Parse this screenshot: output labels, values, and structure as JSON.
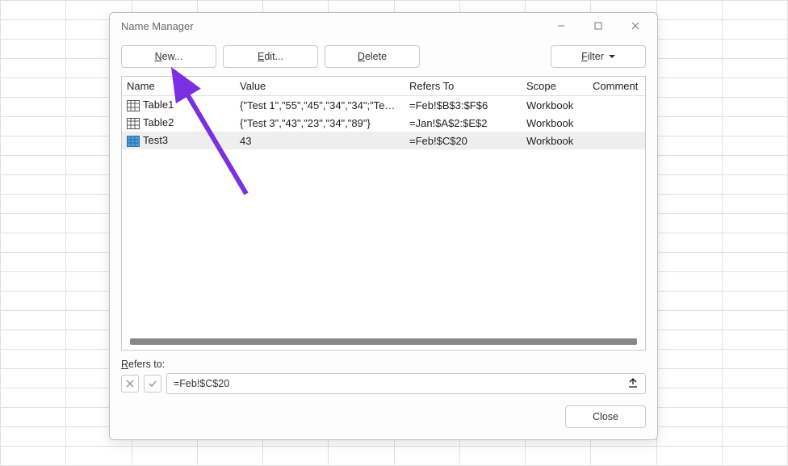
{
  "window": {
    "title": "Name Manager"
  },
  "toolbar": {
    "new_label": "New...",
    "edit_label": "Edit...",
    "delete_label": "Delete",
    "filter_label": "Filter"
  },
  "headers": {
    "name": "Name",
    "value": "Value",
    "refers": "Refers To",
    "scope": "Scope",
    "comment": "Comment"
  },
  "rows": [
    {
      "name": "Table1",
      "icon": "table",
      "value": "{\"Test 1\",\"55\",\"45\",\"34\",\"34\";\"Test...",
      "refers": "=Feb!$B$3:$F$6",
      "scope": "Workbook",
      "comment": "",
      "selected": false
    },
    {
      "name": "Table2",
      "icon": "table",
      "value": "{\"Test 3\",\"43\",\"23\",\"34\",\"89\"}",
      "refers": "=Jan!$A$2:$E$2",
      "scope": "Workbook",
      "comment": "",
      "selected": false
    },
    {
      "name": "Test3",
      "icon": "name",
      "value": "43",
      "refers": "=Feb!$C$20",
      "scope": "Workbook",
      "comment": "",
      "selected": true
    }
  ],
  "refers_to": {
    "label": "Refers to:",
    "value": "=Feb!$C$20"
  },
  "footer": {
    "close": "Close"
  },
  "accent_arrow_color": "#7a2fe0"
}
